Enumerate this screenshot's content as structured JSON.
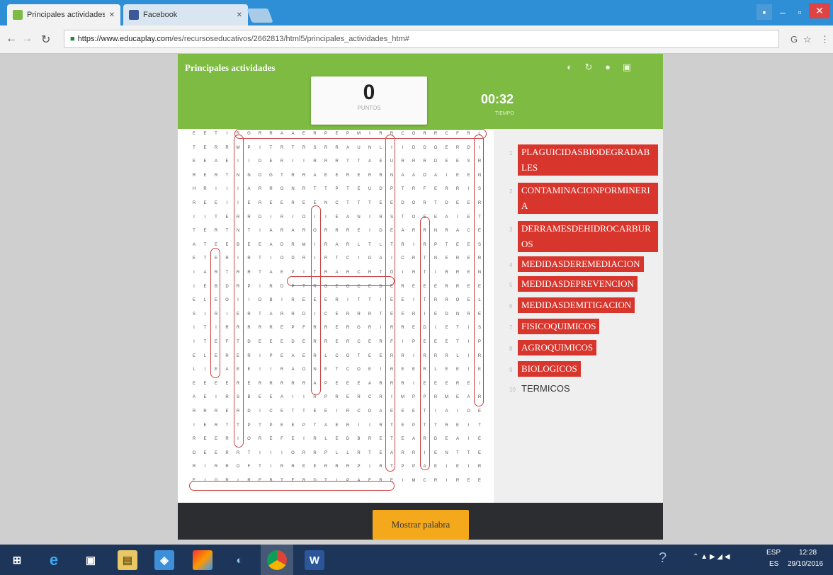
{
  "browser": {
    "tabs": [
      {
        "label": "Principales actividades",
        "icon": "educaplay-favicon",
        "active": true
      },
      {
        "label": "Facebook",
        "icon": "facebook-favicon",
        "active": false
      }
    ],
    "url_host": "https://www.educaplay.com",
    "url_path": "/es/recursoseducativos/2662813/html5/principales_actividades_htm#"
  },
  "activity": {
    "title": "Principales actividades",
    "score": "0",
    "score_label": "PUNTOS",
    "timer": "00:32",
    "timer_label": "TIEMPO",
    "reveal_button": "Mostrar palabra",
    "header_icons": [
      "info-icon",
      "restart-icon",
      "help-icon",
      "fullscreen-icon"
    ]
  },
  "grid": {
    "rows": [
      "EETIRGRRAAERPEPMIRRCORRCFRL",
      "TERRMPITRTRSRRAUNLIIDDOERDI",
      "EEAEIIDERIIRRRTTAEURRRDEESR",
      "RERTNNDGTRRAEERERRNAAOAIEEN",
      "HRIIIARRONRTTPTEUDPTRFERRIS",
      "REEIIEREEREENCTTTEEDORTDEER",
      "IITERRDIRIOIIEANIRSTOEEAIET",
      "TERTNTIARARORRREIDEARRNRACE",
      "ATEEBEEADRMIRARLTLTRIRPTEES",
      "ETERIRTIODRIRTCIGAICRTNERER",
      "IARTRRTAEPITRARCRTOIRTIRREN",
      "IEBDRPIRDPTROEOCEDEREEERREE",
      "ELEOIIDBIREEERITTIEEITRROEL",
      "SIRIERTARRDICERRRTEERIEDNRE",
      "ITIRRRRREPFRRERGRIRREDIETIS",
      "ITEFTDEEEDERRERCERFIPEEETIP",
      "ELERERIPEAERLCOTEERRIRRRLIR",
      "LIEAEEIIRAONETCOEIREERLEEIE",
      "EEEERERRRRRAPEEEARRRIEEEREI",
      "AEIRSBEEAIIRPRERCRIMPPRMEAR",
      "RRRERDICETTEEIRCOAEEETIAIOE",
      "IERTTPTPEEPTAERIIRTEPTTREIT",
      "REERIOREFEIRLEDBRETEARDEAIE",
      "OEERRTIIIORRPLLRTEARRIENTTE",
      "RIRROFTIRREERRRPIRTPPAEIEIR",
      "EIORIREBTERDTIPAEREIMCRIREE"
    ],
    "found_words_count": 9
  },
  "word_list": [
    {
      "n": "1",
      "text": "PLAGUICIDASBIODEGRADABLES",
      "found": true
    },
    {
      "n": "2",
      "text": "CONTAMINACIONPORMINERIA",
      "found": true
    },
    {
      "n": "3",
      "text": "DERRAMESDEHIDROCARBUROS",
      "found": true
    },
    {
      "n": "4",
      "text": "MEDIDASDEREMEDIACION",
      "found": true
    },
    {
      "n": "5",
      "text": "MEDIDASDEPREVENCION",
      "found": true
    },
    {
      "n": "6",
      "text": "MEDIDASDEMITIGACION",
      "found": true
    },
    {
      "n": "7",
      "text": "FISICOQUIMICOS",
      "found": true
    },
    {
      "n": "8",
      "text": "AGROQUIMICOS",
      "found": true
    },
    {
      "n": "9",
      "text": "BIOLOGICOS",
      "found": true
    },
    {
      "n": "10",
      "text": "TERMICOS",
      "found": false
    }
  ],
  "taskbar": {
    "apps": [
      "windows-start-icon",
      "internet-explorer-icon",
      "store-icon",
      "file-explorer-icon",
      "shield-app-icon",
      "photos-icon",
      "paint-icon",
      "chrome-icon",
      "word-icon"
    ],
    "lang_top": "ESP",
    "lang_bottom": "ES",
    "time": "12:28",
    "date": "29/10/2016"
  }
}
